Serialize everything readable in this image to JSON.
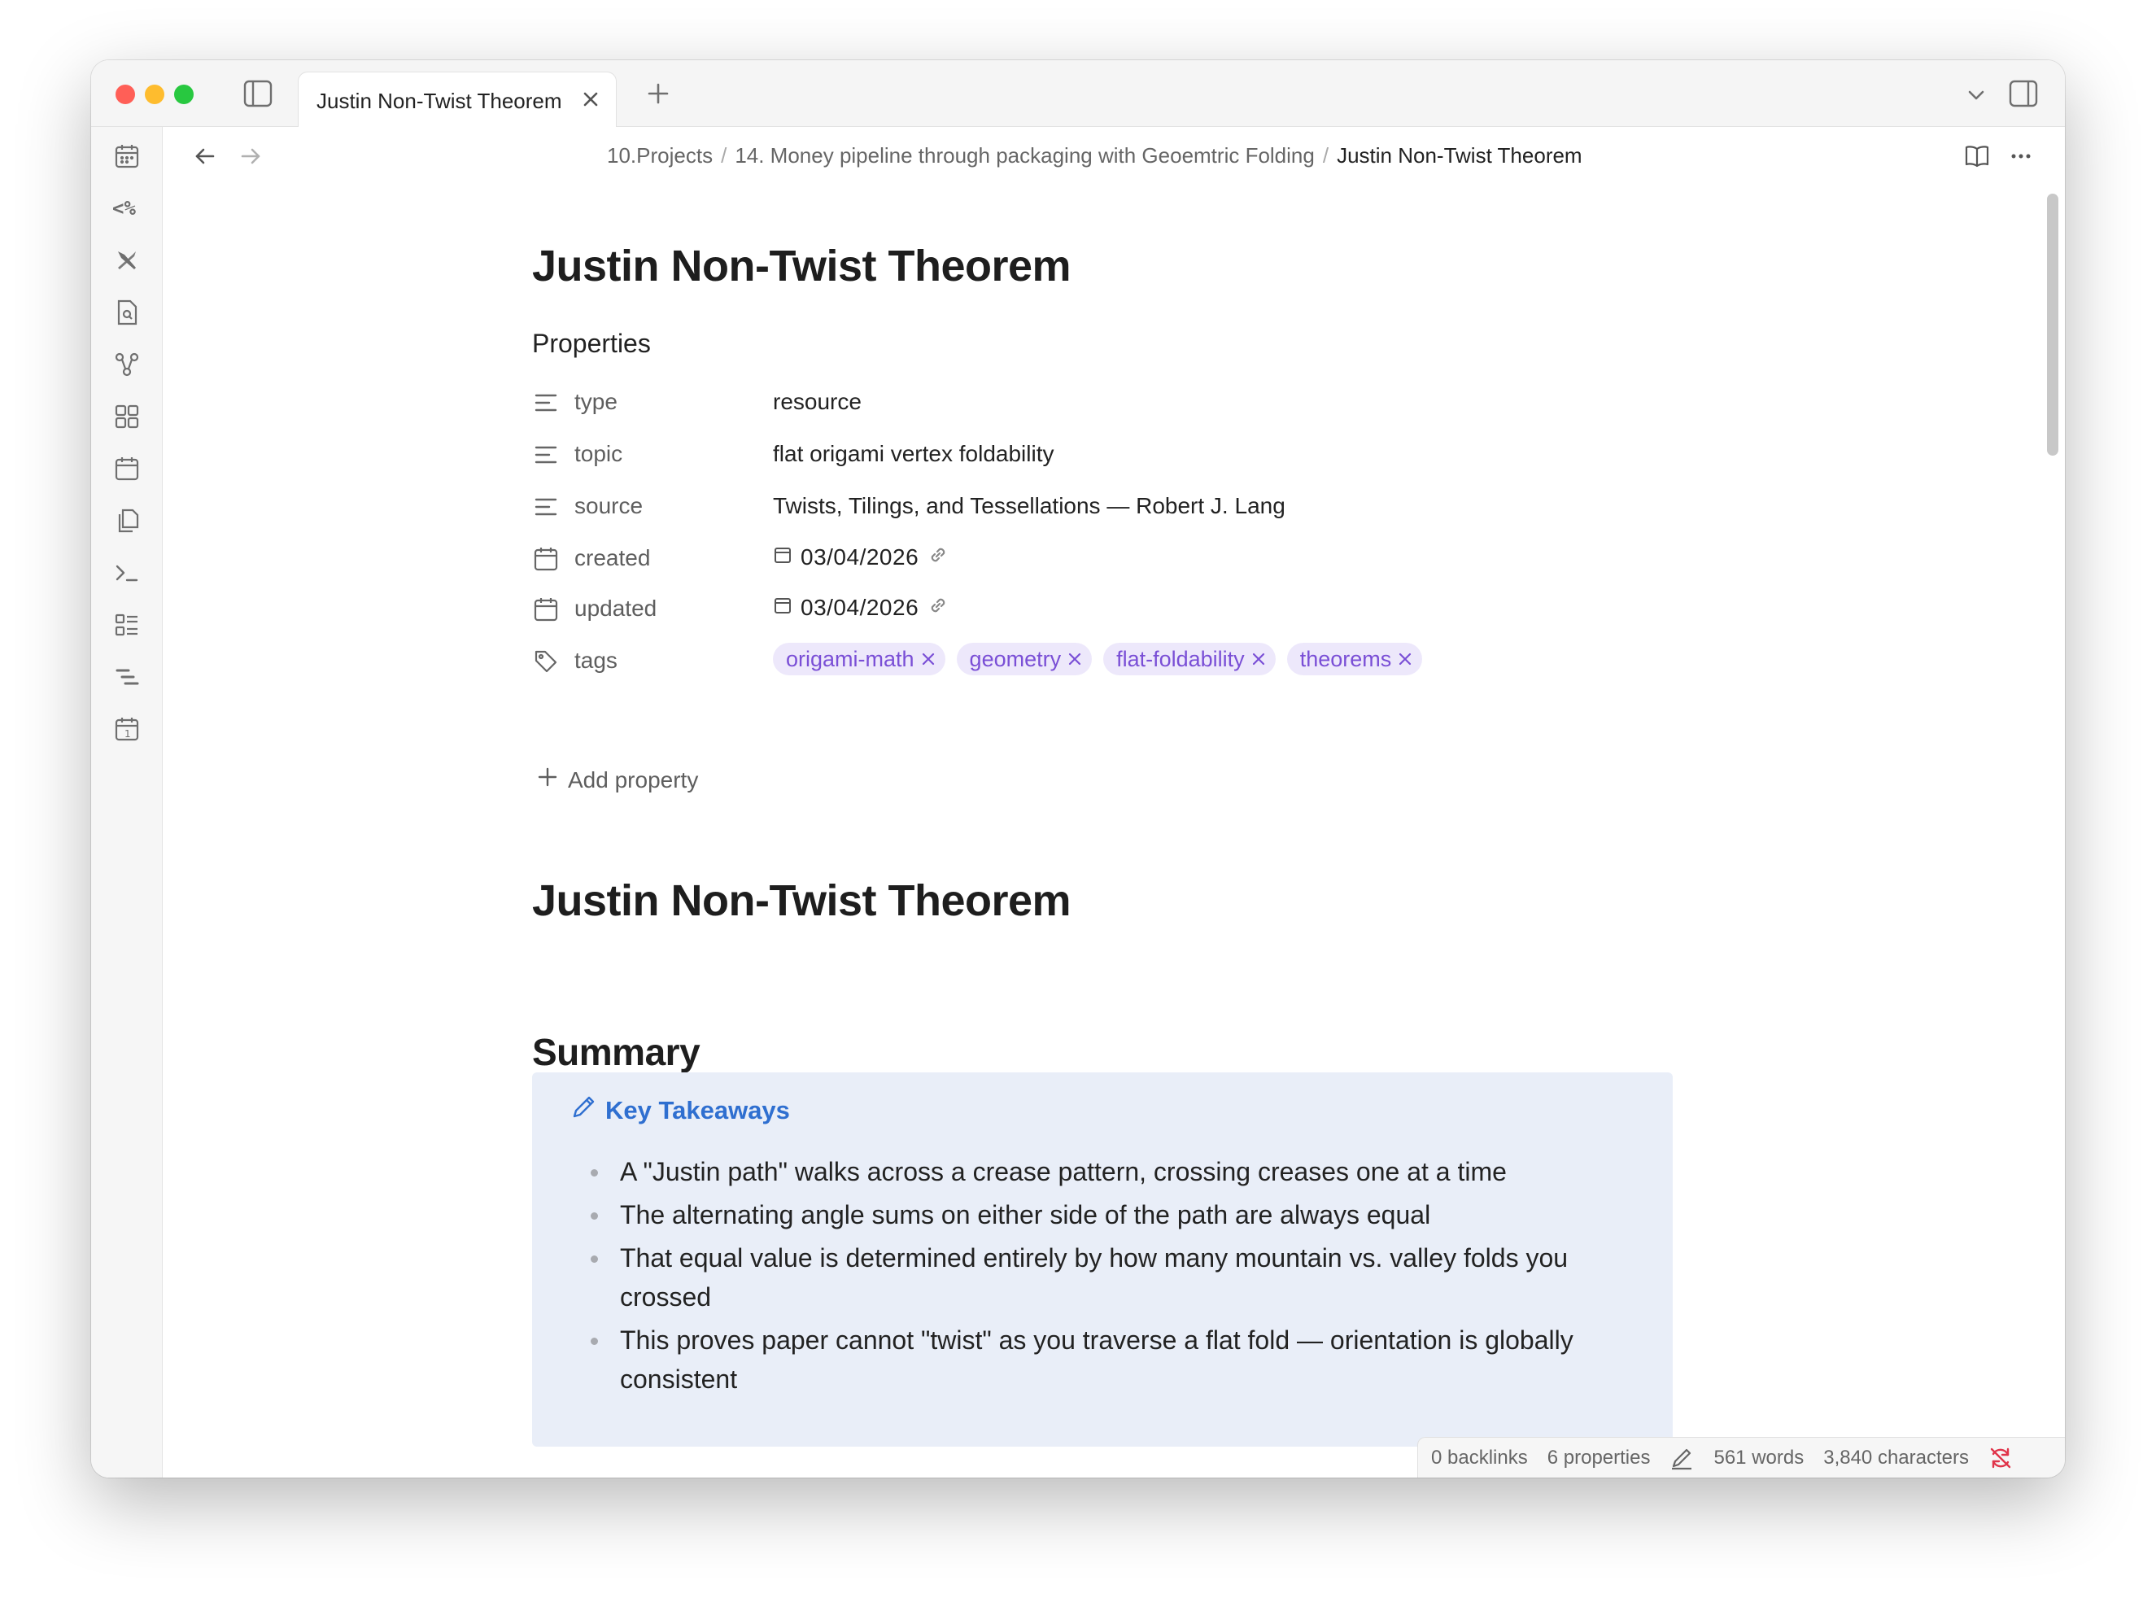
{
  "tab": {
    "title": "Justin Non-Twist Theorem"
  },
  "breadcrumb": [
    "10.Projects",
    "14. Money pipeline through packaging with Geoemtric Folding",
    "Justin Non-Twist Theorem"
  ],
  "note": {
    "title": "Justin Non-Twist Theorem",
    "properties_heading": "Properties",
    "properties": [
      {
        "key": "type",
        "value": "resource",
        "icon": "text-lines-icon"
      },
      {
        "key": "topic",
        "value": "flat origami vertex foldability",
        "icon": "text-lines-icon"
      },
      {
        "key": "source",
        "value": "Twists, Tilings, and Tessellations — Robert J. Lang",
        "icon": "text-lines-icon"
      },
      {
        "key": "created",
        "value": "03/04/2026",
        "icon": "calendar-icon"
      },
      {
        "key": "updated",
        "value": "03/04/2026",
        "icon": "calendar-icon"
      },
      {
        "key": "tags",
        "values": [
          "origami-math",
          "geometry",
          "flat-foldability",
          "theorems"
        ],
        "icon": "tag-icon"
      }
    ],
    "add_property": "Add property",
    "body_title": "Justin Non-Twist Theorem",
    "summary_heading": "Summary",
    "callout": {
      "title": "Key Takeaways",
      "items": [
        "A \"Justin path\" walks across a crease pattern, crossing creases one at a time",
        "The alternating angle sums on either side of the path are always equal",
        "That equal value is determined entirely by how many mountain vs. valley folds you crossed",
        "This proves paper cannot \"twist\" as you traverse a flat fold — orientation is globally consistent"
      ]
    }
  },
  "status": {
    "backlinks": "0 backlinks",
    "properties": "6 properties",
    "words": "561 words",
    "characters": "3,840 characters"
  },
  "colors": {
    "tag_bg": "#ede8fb",
    "tag_text": "#7a4fd6",
    "callout_bg": "#e9eef8",
    "callout_title": "#2f6fd0",
    "sync_error": "#e0344a"
  }
}
